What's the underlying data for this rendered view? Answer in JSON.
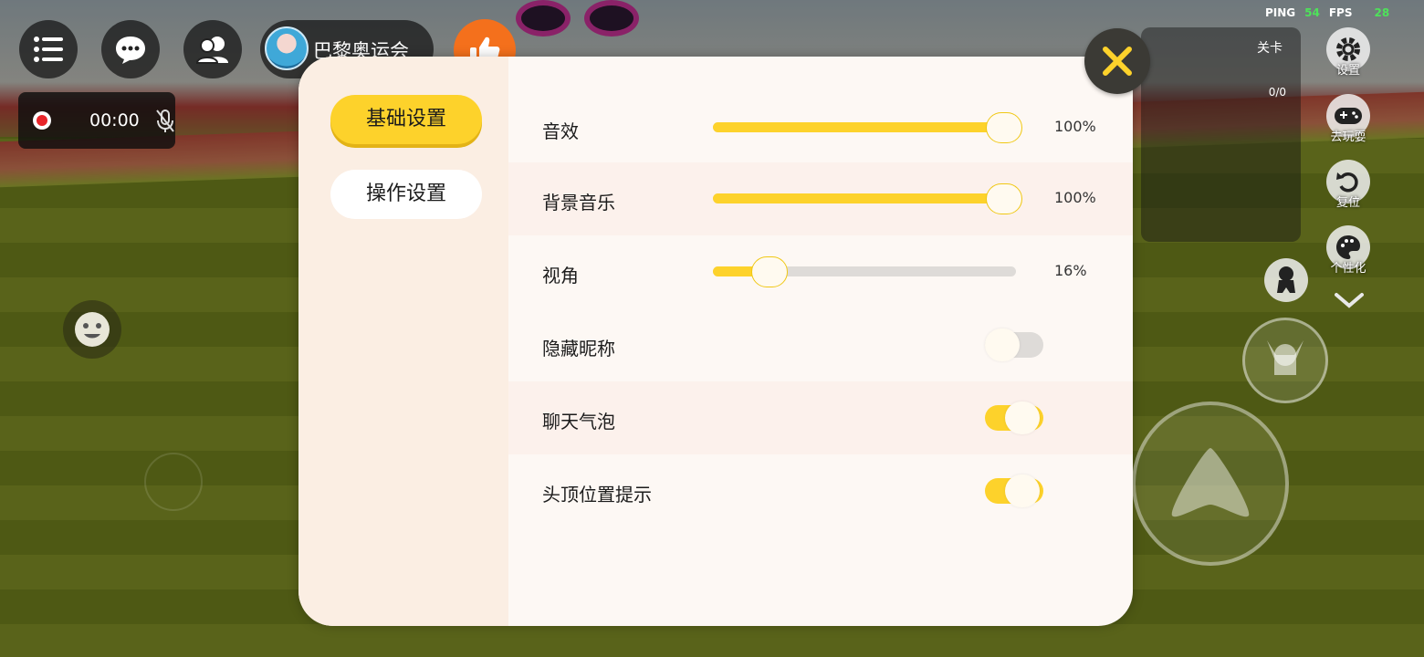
{
  "net": {
    "ping_label": "PING",
    "ping_value": "54",
    "fps_label": "FPS",
    "fps_value": "28"
  },
  "room": {
    "name": "巴黎奥运会"
  },
  "recording": {
    "time": "00:00"
  },
  "level_panel": {
    "title": "关卡",
    "count": "0/0"
  },
  "side_buttons": {
    "settings": "设置",
    "play": "去玩耍",
    "reset": "复位",
    "customize": "个性化"
  },
  "settings_dialog": {
    "tabs": [
      {
        "label": "基础设置",
        "selected": true
      },
      {
        "label": "操作设置",
        "selected": false
      }
    ],
    "sliders": [
      {
        "label": "音效",
        "value": 100,
        "display": "100%"
      },
      {
        "label": "背景音乐",
        "value": 100,
        "display": "100%"
      },
      {
        "label": "视角",
        "value": 16,
        "display": "16%"
      }
    ],
    "toggles": [
      {
        "label": "隐藏昵称",
        "on": false
      },
      {
        "label": "聊天气泡",
        "on": true
      },
      {
        "label": "头顶位置提示",
        "on": true
      }
    ]
  },
  "colors": {
    "accent_yellow": "#fdd22b",
    "like_orange": "#f4701c",
    "record_red": "#e8252a",
    "stat_green": "#4ee25a",
    "dialog_bg": "#fdf8f4",
    "sidebar_bg": "#fbeee3"
  },
  "icons": {
    "menu": "list-icon",
    "chat": "chat-bubble-icon",
    "friends": "friends-icon",
    "like": "thumbs-up-icon",
    "mic": "mic-muted-icon",
    "close": "close-icon",
    "emoji": "smiley-icon"
  }
}
